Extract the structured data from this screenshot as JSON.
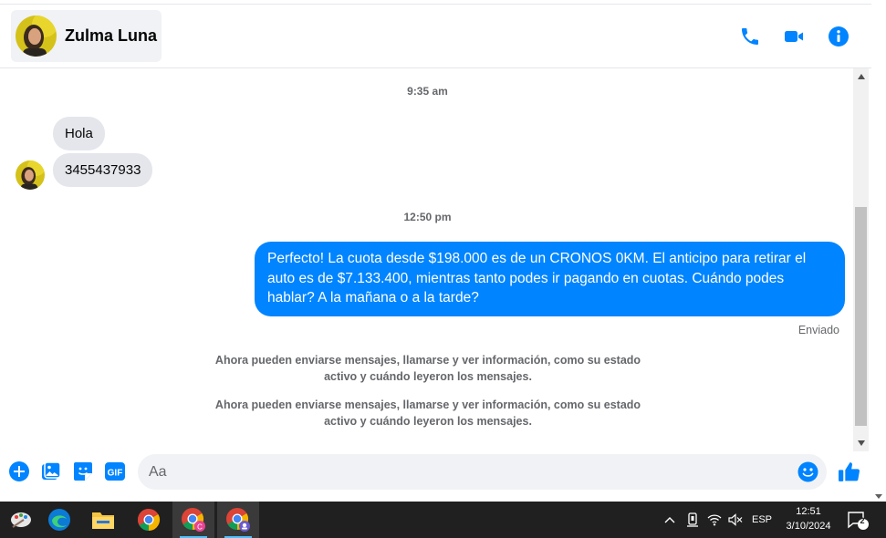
{
  "header": {
    "contact_name": "Zulma Luna",
    "icons": [
      "phone-icon",
      "video-icon",
      "info-icon"
    ],
    "accent": "#0084ff"
  },
  "messages": {
    "timestamp_1": "9:35 am",
    "incoming": [
      "Hola",
      "3455437933"
    ],
    "timestamp_2": "12:50 pm",
    "outgoing": "Perfecto! La cuota desde $198.000 es de un CRONOS 0KM. El anticipo para retirar el auto es de $7.133.400, mientras tanto podes ir pagando en cuotas. Cuándo podes hablar? A la mañana o a la tarde?",
    "status": "Enviado",
    "notices": [
      "Ahora pueden enviarse mensajes, llamarse y ver información, como su estado activo y cuándo leyeron los mensajes.",
      "Ahora pueden enviarse mensajes, llamarse y ver información, como su estado activo y cuándo leyeron los mensajes."
    ]
  },
  "composer": {
    "placeholder": "Aa",
    "icons": [
      "plus-icon",
      "photo-icon",
      "sticker-icon",
      "gif-icon",
      "emoji-icon",
      "like-icon"
    ],
    "gif_label": "GIF"
  },
  "taskbar": {
    "apps": [
      "paint-icon",
      "edge-icon",
      "file-explorer-icon",
      "chrome-icon",
      "chrome-profile-c-icon",
      "chrome-profile-incognito-icon"
    ],
    "language": "ESP",
    "time": "12:51",
    "date": "3/10/2024",
    "notification_count": "2"
  }
}
